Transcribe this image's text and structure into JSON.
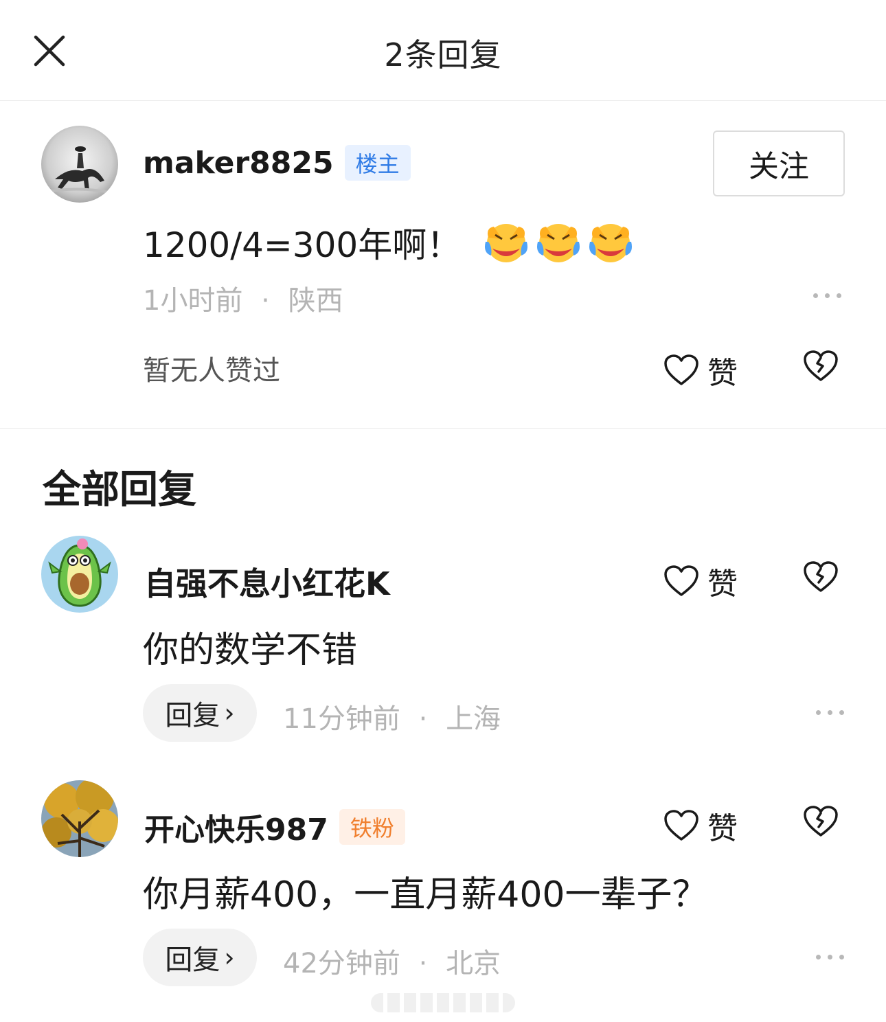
{
  "header": {
    "title": "2条回复"
  },
  "main_comment": {
    "username": "maker8825",
    "badge": "楼主",
    "follow_label": "关注",
    "text": "1200/4=300年啊！",
    "emojis": [
      "laughing-crying-emoji",
      "laughing-crying-emoji",
      "laughing-crying-emoji"
    ],
    "time": "1小时前",
    "location": "陕西",
    "likes_text": "暂无人赞过",
    "like_label": "赞"
  },
  "section": {
    "title": "全部回复"
  },
  "replies": [
    {
      "username": "自强不息小红花K",
      "badge": "",
      "text": "你的数学不错",
      "like_label": "赞",
      "reply_label": "回复",
      "time": "11分钟前",
      "location": "上海"
    },
    {
      "username": "开心快乐987",
      "badge": "铁粉",
      "text": "你月薪400，一直月薪400一辈子？",
      "like_label": "赞",
      "reply_label": "回复",
      "time": "42分钟前",
      "location": "北京"
    }
  ],
  "separator": "·",
  "colors": {
    "op_badge_bg": "#e8f1ff",
    "op_badge_text": "#2f7be6",
    "fan_badge_bg": "#fff0e6",
    "fan_badge_text": "#f07f2e",
    "meta_text": "#b4b4b4"
  }
}
